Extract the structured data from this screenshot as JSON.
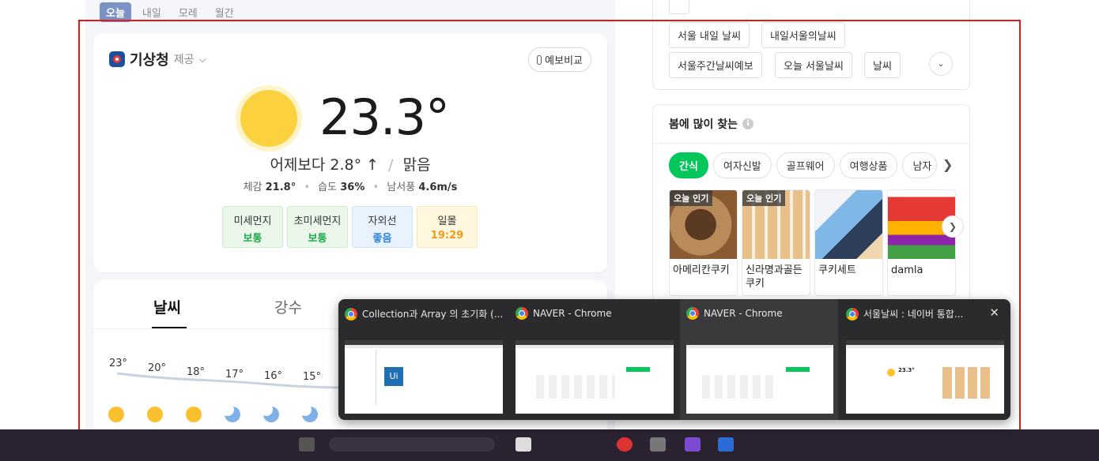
{
  "day_tabs": [
    {
      "label": "오늘",
      "active": true
    },
    {
      "label": "내일",
      "active": false
    },
    {
      "label": "모레",
      "active": false
    },
    {
      "label": "월간",
      "active": false
    }
  ],
  "weather": {
    "provider": "기상청",
    "provider_suffix": "제공",
    "compare_button": "예보비교",
    "temperature": "23.3°",
    "summary_prefix": "어제보다",
    "summary_diff": "2.8° ↑",
    "summary_sep": "/",
    "condition": "맑음",
    "feels_label": "체감",
    "feels_value": "21.8°",
    "humidity_label": "습도",
    "humidity_value": "36%",
    "wind_label": "남서풍",
    "wind_value": "4.6m/s",
    "badges": [
      {
        "label": "미세먼지",
        "value": "보통",
        "tone": "green"
      },
      {
        "label": "초미세먼지",
        "value": "보통",
        "tone": "green"
      },
      {
        "label": "자외선",
        "value": "좋음",
        "tone": "blue"
      },
      {
        "label": "일몰",
        "value": "19:29",
        "tone": "yellow"
      }
    ]
  },
  "hourly": {
    "tabs": [
      "날씨",
      "강수"
    ],
    "temps": [
      "23°",
      "20°",
      "18°",
      "17°",
      "16°",
      "15°"
    ],
    "icons": [
      "sun-icon",
      "sun-icon",
      "sun-icon",
      "moon-icon",
      "moon-icon",
      "moon-icon"
    ]
  },
  "keywords": {
    "rows": [
      [
        "서울 내일 날씨",
        "내일서울의날씨"
      ],
      [
        "서울주간날씨예보",
        "오늘 서울날씨",
        "날씨"
      ]
    ]
  },
  "spring": {
    "title": "봄에 많이 찾는",
    "chips": [
      "간식",
      "여자신발",
      "골프웨어",
      "여행상품",
      "남자"
    ],
    "products": [
      {
        "name": "아메리칸쿠키",
        "badge": "오늘 인기"
      },
      {
        "name": "신라명과골든쿠키",
        "badge": "오늘 인기"
      },
      {
        "name": "쿠키세트",
        "badge": ""
      },
      {
        "name": "damla",
        "badge": ""
      }
    ]
  },
  "switcher": {
    "windows": [
      {
        "title": "Collection과 Array 의 초기화 (..."
      },
      {
        "title": "NAVER - Chrome"
      },
      {
        "title": "NAVER - Chrome"
      },
      {
        "title": "서울날씨 : 네이버 통합..."
      }
    ],
    "thumb_temp": "23.3°"
  },
  "colors": {
    "accent_green": "#03c75a",
    "selection_red": "#e01b1b",
    "sun": "#fbd140"
  }
}
